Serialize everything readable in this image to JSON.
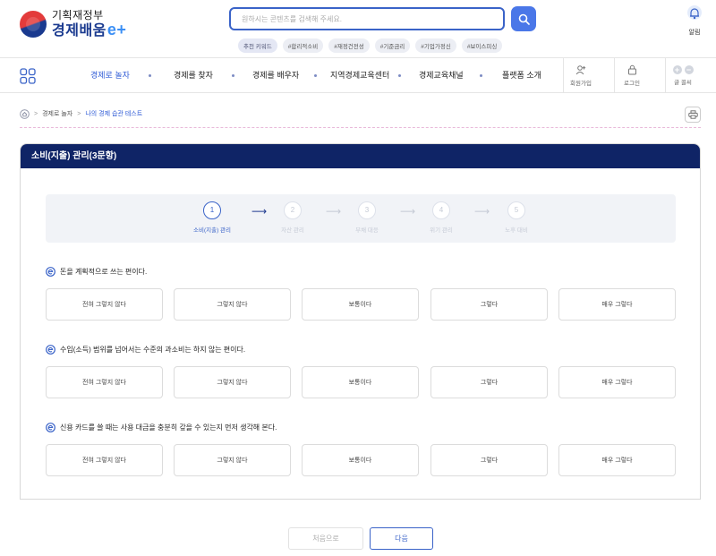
{
  "header": {
    "ministry": "기획재정부",
    "brand": "경제배움",
    "brand_suffix": "e+",
    "search_placeholder": "원하시는 콘텐츠를 검색해 주세요.",
    "keywords_label": "추천 키워드",
    "keywords": [
      "#합리적소비",
      "#재정건전성",
      "#기준금리",
      "#기업가정신",
      "#보이스피싱"
    ],
    "alarm_label": "알림"
  },
  "nav": {
    "items": [
      "경제로 놀자",
      "경제를 찾자",
      "경제를 배우자",
      "지역경제교육센터",
      "경제교육채널",
      "플랫폼 소개"
    ],
    "active_index": 0,
    "signup_label": "회원가입",
    "login_label": "로그인",
    "font_label": "글 꼴씨"
  },
  "breadcrumb": {
    "items": [
      "경제로 놀자",
      "나의 경제 습관 테스트"
    ]
  },
  "panel": {
    "title": "소비(지출) 관리(3문항)",
    "steps": [
      {
        "num": "1",
        "label": "소비(지출) 관리"
      },
      {
        "num": "2",
        "label": "자산 관리"
      },
      {
        "num": "3",
        "label": "부채 대응"
      },
      {
        "num": "4",
        "label": "위기 관리"
      },
      {
        "num": "5",
        "label": "노후 대비"
      }
    ],
    "current_step": 1,
    "questions": [
      "돈을 계획적으로 쓰는 편이다.",
      "수입(소득) 범위를 넘어서는 수준의 과소비는 하지 않는 편이다.",
      "신용 카드를 쓸 때는 사용 대금을 충분히 갚을 수 있는지 먼저 생각해 본다."
    ],
    "options": [
      "전혀 그렇지 않다",
      "그렇지 않다",
      "보통이다",
      "그렇다",
      "매우 그렇다"
    ]
  },
  "footer": {
    "prev_label": "처음으로",
    "next_label": "다음"
  },
  "colors": {
    "accent": "#3a63c8",
    "panel_header": "#0f2466",
    "brand_blue": "#1a3a8f",
    "emblem_red": "#e33b3b"
  },
  "icons": [
    "emblem-logo",
    "search-icon",
    "bell-icon",
    "grid-menu-icon",
    "person-add-icon",
    "lock-icon",
    "home-icon",
    "printer-icon",
    "question-e-icon",
    "arrow-right-icon"
  ]
}
